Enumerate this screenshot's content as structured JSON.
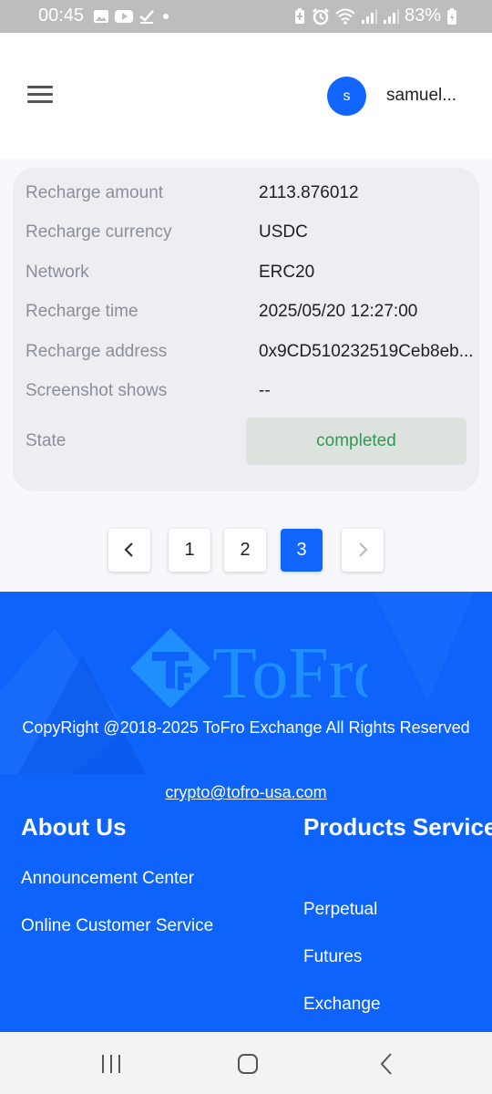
{
  "status_bar": {
    "time": "00:45",
    "battery_percent": "83%",
    "left_icons": [
      "gallery-icon",
      "youtube-icon",
      "check-icon",
      "dot-icon"
    ],
    "right_icons": [
      "battery-saver-icon",
      "alarm-icon",
      "wifi-icon",
      "signal-icon",
      "signal-icon",
      "battery-charging-icon"
    ]
  },
  "header": {
    "menu_icon": "hamburger-menu-icon",
    "avatar_letter": "s",
    "username": "samuel...",
    "accent_color": "#1166ff"
  },
  "record": {
    "rows": [
      {
        "label": "Recharge amount",
        "value": "2113.876012"
      },
      {
        "label": "Recharge currency",
        "value": "USDC"
      },
      {
        "label": "Network",
        "value": "ERC20"
      },
      {
        "label": "Recharge time",
        "value": "2025/05/20 12:27:00"
      },
      {
        "label": "Recharge address",
        "value": "0x9CD510232519Ceb8eb..."
      },
      {
        "label": "Screenshot shows",
        "value": "--"
      }
    ],
    "state_label": "State",
    "state_value": "completed",
    "state_color": "#2f9a54"
  },
  "pagination": {
    "prev_icon": "chevron-left-icon",
    "next_icon": "chevron-right-icon",
    "pages": [
      "1",
      "2",
      "3"
    ],
    "current_page": "3"
  },
  "footer": {
    "logo_text": "ToFro",
    "copyright": "CopyRight @2018-2025 ToFro Exchange All Rights Reserved",
    "email": "crypto@tofro-usa.com",
    "about_title": "About Us",
    "about_links": [
      "Announcement Center",
      "Online Customer Service"
    ],
    "products_title": "Products Service",
    "product_links": [
      "Perpetual",
      "Futures",
      "Exchange"
    ],
    "background_color": "#0d63fa"
  },
  "nav_bar": {
    "icons": [
      "recent-apps-icon",
      "home-icon",
      "back-icon"
    ]
  }
}
